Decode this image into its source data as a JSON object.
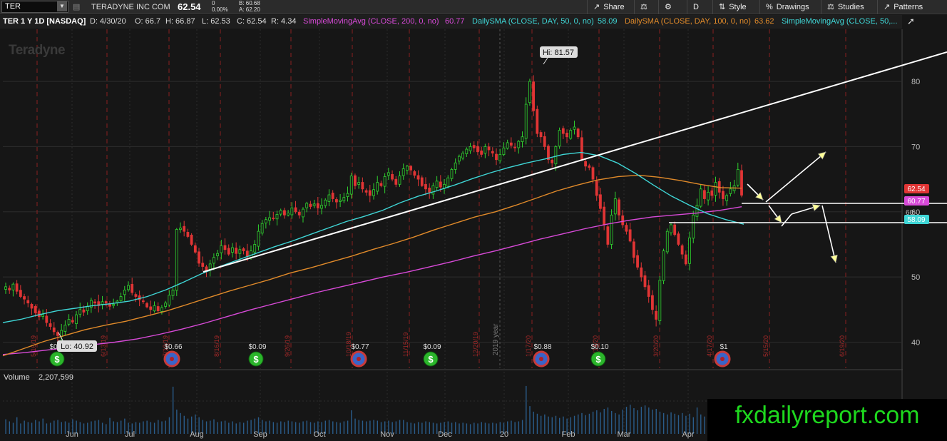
{
  "toolbar": {
    "symbol": "TER",
    "company": "TERADYNE INC COM",
    "last_price": "62.54",
    "change_top": "0",
    "change_pct": "0.00%",
    "bid": "B: 60.68",
    "ask": "A: 62.20",
    "share_label": "Share",
    "timeframe_label": "D",
    "style_label": "Style",
    "drawings_label": "Drawings",
    "studies_label": "Studies",
    "patterns_label": "Patterns"
  },
  "study_bar": {
    "symbol_info": "TER 1 Y 1D [NASDAQ]",
    "date": "D: 4/30/20",
    "open": "O: 66.7",
    "high": "H: 66.87",
    "low": "L: 62.53",
    "close": "C: 62.54",
    "range": "R: 4.34",
    "sma200_label": "SimpleMovingAvg (CLOSE, 200, 0, no)",
    "sma200_value": "60.77",
    "sma50_label": "DailySMA (CLOSE, DAY, 50, 0, no)",
    "sma50_value": "58.09",
    "sma100_label": "DailySMA (CLOSE, DAY, 100, 0, no)",
    "sma100_value": "63.62",
    "sma50b_label": "SimpleMovingAvg (CLOSE, 50,..."
  },
  "volume_bar": {
    "label": "Volume",
    "value": "2,207,599"
  },
  "watermark_chart": "Teradyne",
  "watermark_site": "fxdailyreport.com",
  "colors": {
    "up": "#2fd22f",
    "down": "#e03535",
    "sma50": "#3fd6d6",
    "sma100": "#e08a2a",
    "sma200": "#d84ad8",
    "trend": "#ffffff",
    "arrow_head": "#ffff99",
    "background": "#161616",
    "grid": "#2c2c2c",
    "earnings_marker": "#b0202a",
    "site_text": "#1ed81e"
  },
  "chart_data": {
    "type": "candlestick",
    "ylim": [
      36,
      88
    ],
    "yticks": [
      40,
      50,
      60,
      70,
      80
    ],
    "months": [
      "Jun",
      "Jul",
      "Aug",
      "Sep",
      "Oct",
      "Nov",
      "Dec",
      "20",
      "Feb",
      "Mar",
      "Apr"
    ],
    "year_label": "2019 year",
    "annotations": {
      "high": "Hi: 81.57",
      "low": "Lo: 40.92"
    },
    "price_bubbles": [
      {
        "label": "62.54",
        "value": 62.54,
        "color": "#e03535"
      },
      {
        "label": "60.77",
        "value": 60.77,
        "color": "#d84ad8"
      },
      {
        "label": "58.09",
        "value": 58.09,
        "color": "#3fd6d6"
      }
    ],
    "extra_axis_label": "60",
    "dividends": [
      {
        "label": "$0.09",
        "type": "dividend"
      },
      {
        "label": "$0.66",
        "type": "earnings"
      },
      {
        "label": "$0.09",
        "type": "dividend"
      },
      {
        "label": "$0.77",
        "type": "earnings"
      },
      {
        "label": "$0.09",
        "type": "dividend"
      },
      {
        "label": "$0.88",
        "type": "earnings"
      },
      {
        "label": "$0.10",
        "type": "dividend"
      },
      {
        "label": "$1",
        "type": "earnings"
      }
    ],
    "date_markers": [
      "5/16/19",
      "6/13/19",
      "7/19/19",
      "8/16/19",
      "9/26/19",
      "10/18/19",
      "11/15/19",
      "12/20/19",
      "1/17/20",
      "2/14/20",
      "3/20/20",
      "4/17/20",
      "5/15/20",
      "6/19/20"
    ],
    "close": [
      48.5,
      48.0,
      48.9,
      47.8,
      47.0,
      46.6,
      46.0,
      45.2,
      44.5,
      43.9,
      44.2,
      43.0,
      42.4,
      41.6,
      41.0,
      41.8,
      42.6,
      43.5,
      43.1,
      44.2,
      45.0,
      44.6,
      45.5,
      46.4,
      46.0,
      45.6,
      46.2,
      46.0,
      45.5,
      45.8,
      46.3,
      47.0,
      48.0,
      48.7,
      47.6,
      47.0,
      46.5,
      46.2,
      45.4,
      45.0,
      45.6,
      44.8,
      45.3,
      46.0,
      47.2,
      48.0,
      57.3,
      57.5,
      57.0,
      56.2,
      55.0,
      53.8,
      52.1,
      51.6,
      51.0,
      52.0,
      53.0,
      53.6,
      54.8,
      54.2,
      53.5,
      54.5,
      53.6,
      54.2,
      54.0,
      53.2,
      54.0,
      55.0,
      57.0,
      58.2,
      58.8,
      59.1,
      59.0,
      59.6,
      60.2,
      59.5,
      59.8,
      60.6,
      60.0,
      59.5,
      60.4,
      61.3,
      60.8,
      61.2,
      60.6,
      61.0,
      61.8,
      62.6,
      62.0,
      61.5,
      61.8,
      62.2,
      62.8,
      65.5,
      64.0,
      64.5,
      63.5,
      63.0,
      62.5,
      63.4,
      64.5,
      64.0,
      65.4,
      66.0,
      65.0,
      64.2,
      65.5,
      66.6,
      67.0,
      66.4,
      65.6,
      65.0,
      64.0,
      63.5,
      63.0,
      64.0,
      64.7,
      63.8,
      64.2,
      65.2,
      66.5,
      67.5,
      68.5,
      69.0,
      69.6,
      70.0,
      69.8,
      69.2,
      68.8,
      70.0,
      69.5,
      69.0,
      68.0,
      68.8,
      69.8,
      70.6,
      70.2,
      69.8,
      70.8,
      71.5,
      76.5,
      80.0,
      75.5,
      72.0,
      71.5,
      70.0,
      68.0,
      67.5,
      70.0,
      72.5,
      72.0,
      71.5,
      72.5,
      73.0,
      71.5,
      68.0,
      67.0,
      66.8,
      65.0,
      62.5,
      60.5,
      58.0,
      55.0,
      59.5,
      62.0,
      59.5,
      58.0,
      57.0,
      55.5,
      53.0,
      51.5,
      50.0,
      48.5,
      47.0,
      45.0,
      43.5,
      49.5,
      54.0,
      57.0,
      58.0,
      56.5,
      55.0,
      53.5,
      52.0,
      56.0,
      59.5,
      61.0,
      63.5,
      62.0,
      63.0,
      62.5,
      64.5,
      63.0,
      62.0,
      62.5,
      63.5,
      64.0,
      66.5,
      62.54
    ],
    "sma50": [
      43.0,
      43.5,
      44.2,
      44.8,
      45.2,
      45.6,
      45.9,
      46.3,
      47.0,
      48.0,
      49.2,
      50.5,
      51.6,
      52.6,
      53.6,
      54.6,
      55.5,
      56.5,
      57.5,
      58.5,
      59.3,
      60.2,
      61.4,
      62.4,
      63.2,
      64.1,
      65.1,
      66.0,
      66.8,
      67.5,
      68.1,
      68.8,
      69.1,
      68.6,
      67.5,
      65.9,
      64.1,
      62.4,
      61.0,
      59.7,
      58.8,
      58.09
    ],
    "sma100": [
      37.9,
      39.0,
      40.1,
      41.0,
      41.9,
      42.6,
      43.2,
      44.0,
      44.8,
      45.8,
      46.8,
      47.8,
      48.7,
      49.6,
      50.6,
      51.4,
      52.3,
      53.2,
      54.2,
      55.1,
      56.1,
      57.2,
      58.2,
      59.2,
      60.0,
      61.0,
      62.1,
      63.2,
      64.1,
      64.9,
      65.4,
      65.6,
      65.3,
      64.8,
      64.2,
      63.7,
      63.62
    ],
    "sma200": [
      38.1,
      38.4,
      38.8,
      39.2,
      39.6,
      40.0,
      40.5,
      41.2,
      42.0,
      42.9,
      43.9,
      44.9,
      45.8,
      46.7,
      47.6,
      48.4,
      49.2,
      50.0,
      50.7,
      51.5,
      52.3,
      53.2,
      54.0,
      54.9,
      55.8,
      56.6,
      57.4,
      58.1,
      58.7,
      59.2,
      59.5,
      59.8,
      60.2,
      60.77
    ],
    "volume": [
      2.1,
      1.8,
      1.6,
      2.4,
      1.5,
      1.9,
      1.7,
      1.6,
      2.0,
      1.8,
      2.2,
      1.5,
      1.6,
      1.9,
      2.0,
      1.7,
      1.8,
      1.6,
      2.1,
      1.9,
      1.7,
      1.5,
      1.6,
      1.8,
      1.9,
      2.0,
      1.6,
      1.4,
      2.3,
      1.8,
      1.7,
      1.9,
      2.2,
      1.6,
      1.5,
      1.7,
      1.6,
      1.8,
      1.9,
      1.7,
      1.6,
      2.0,
      1.8,
      1.9,
      2.4,
      6.8,
      3.5,
      3.0,
      2.6,
      2.2,
      2.5,
      2.8,
      2.4,
      2.0,
      1.8,
      1.9,
      2.1,
      1.7,
      1.8,
      1.9,
      1.6,
      1.8,
      1.5,
      1.7,
      1.6,
      1.9,
      2.0,
      2.2,
      2.4,
      2.0,
      1.8,
      1.9,
      1.7,
      1.6,
      1.8,
      1.7,
      1.9,
      1.8,
      1.7,
      1.6,
      1.8,
      1.9,
      1.7,
      1.6,
      1.8,
      1.7,
      1.9,
      2.0,
      1.8,
      1.7,
      1.6,
      1.8,
      1.9,
      3.4,
      2.2,
      2.0,
      1.9,
      1.8,
      1.9,
      2.0,
      1.9,
      1.7,
      1.8,
      1.9,
      1.7,
      1.8,
      2.0,
      2.0,
      1.7,
      1.6,
      1.5,
      1.7,
      1.6,
      1.8,
      1.7,
      1.6,
      1.5,
      1.6,
      1.7,
      1.8,
      1.6,
      1.7,
      1.5,
      1.6,
      1.5,
      1.4,
      1.6,
      1.5,
      1.7,
      1.6,
      1.5,
      1.6,
      1.5,
      1.7,
      1.6,
      1.8,
      1.9,
      1.7,
      1.8,
      2.0,
      6.9,
      4.0,
      3.2,
      2.9,
      2.6,
      2.8,
      2.5,
      2.4,
      2.6,
      2.3,
      2.5,
      2.2,
      2.4,
      2.6,
      2.8,
      3.0,
      2.7,
      2.9,
      3.2,
      3.4,
      3.1,
      3.6,
      3.8,
      3.3,
      3.0,
      2.8,
      3.5,
      3.9,
      4.2,
      3.7,
      3.4,
      3.9,
      4.1,
      3.8,
      3.5,
      3.6,
      3.2,
      3.0,
      2.8,
      3.1,
      2.9,
      2.7,
      3.0,
      2.6,
      2.9,
      2.4,
      3.8,
      2.8,
      2.5,
      2.3,
      2.4,
      2.6,
      2.2,
      2.3,
      2.5,
      2.8,
      2.4,
      3.5,
      2.2
    ]
  }
}
